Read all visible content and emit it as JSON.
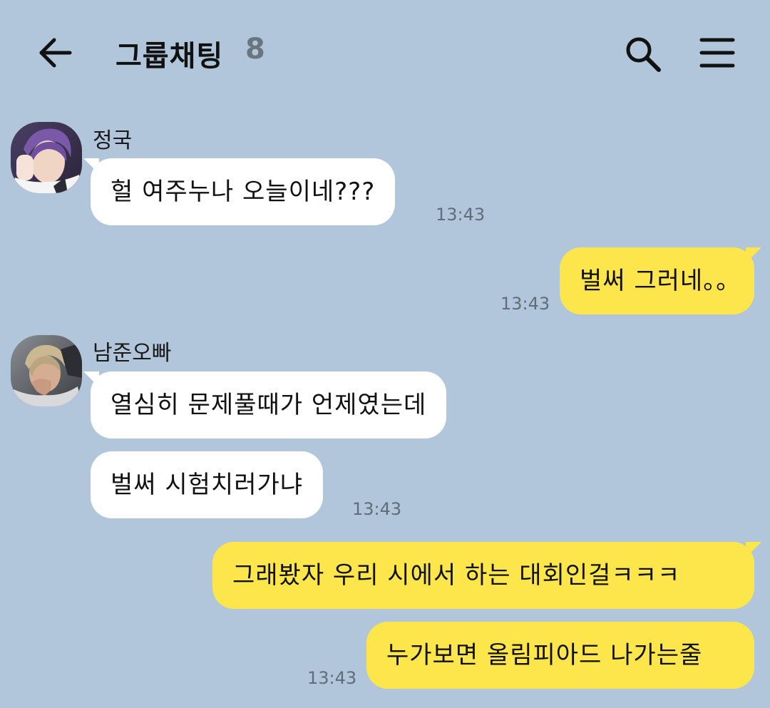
{
  "header": {
    "back_icon": "arrow-left-icon",
    "title": "그룹채팅",
    "member_count": "8",
    "search_icon": "search-icon",
    "menu_icon": "hamburger-menu-icon"
  },
  "colors": {
    "background": "#b1c6da",
    "incoming_bubble": "#ffffff",
    "outgoing_bubble": "#fde64b",
    "timestamp": "#5f6d7c",
    "member_count": "#6b7580"
  },
  "messages": [
    {
      "sender": "정국",
      "direction": "in",
      "text": "헐 여주누나 오늘이네???",
      "time": "13:43"
    },
    {
      "direction": "out",
      "text": "벌써 그러네。。",
      "time": "13:43"
    },
    {
      "sender": "남준오빠",
      "direction": "in",
      "text": "열심히 문제풀때가 언제였는데"
    },
    {
      "direction": "in",
      "text": "벌써 시험치러가냐",
      "time": "13:43"
    },
    {
      "direction": "out",
      "text": "그래봤자 우리 시에서 하는 대회인걸ㅋㅋㅋ"
    },
    {
      "direction": "out",
      "text": "누가보면 올림피아드 나가는줄",
      "time": "13:43"
    }
  ]
}
